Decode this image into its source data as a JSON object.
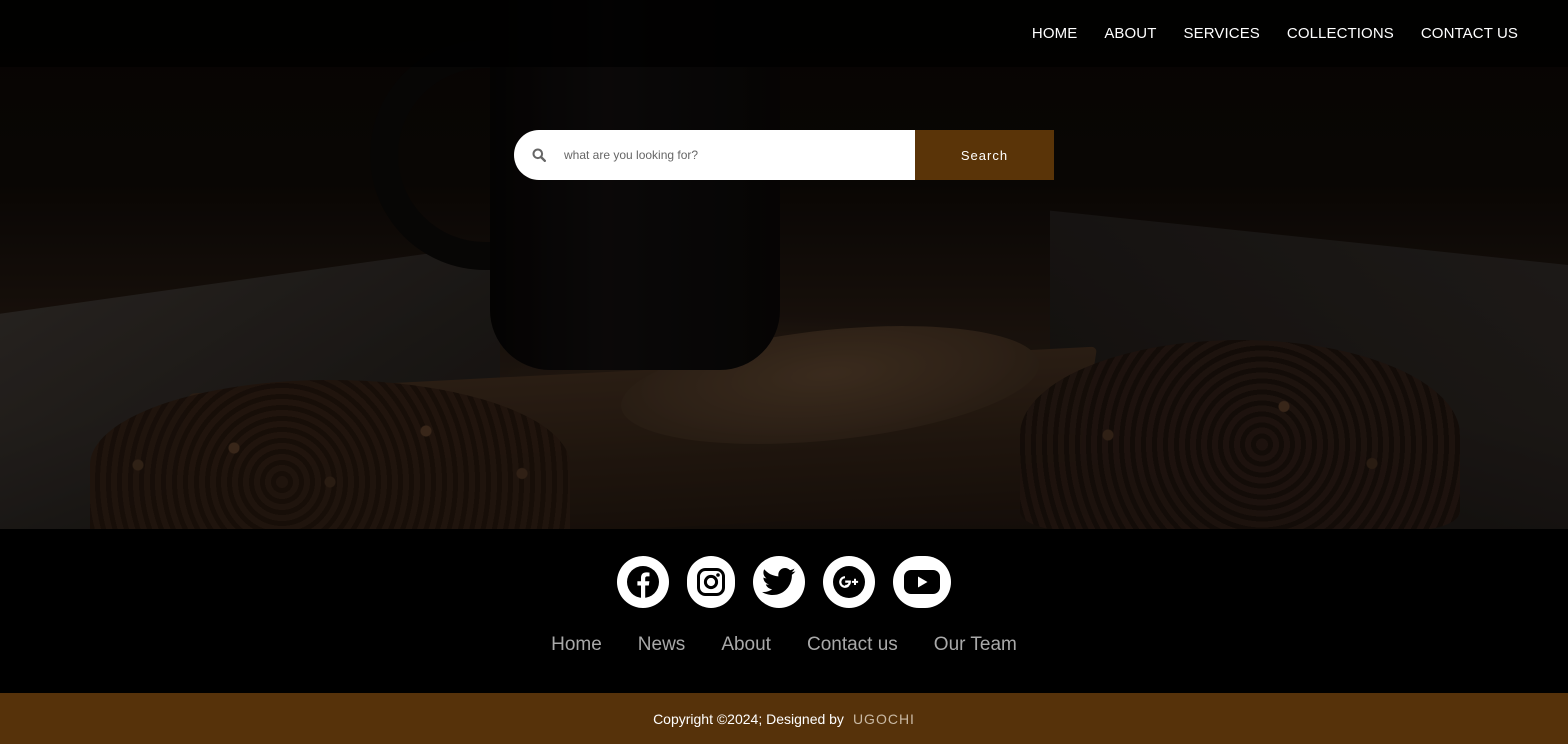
{
  "nav": {
    "items": [
      {
        "label": "HOME"
      },
      {
        "label": "ABOUT"
      },
      {
        "label": "SERVICES"
      },
      {
        "label": "COLLECTIONS"
      },
      {
        "label": "CONTACT US"
      }
    ]
  },
  "search": {
    "placeholder": "what are you looking for?",
    "value": "",
    "button_label": "Search",
    "icon": "search-icon"
  },
  "social": {
    "icons": [
      "facebook-icon",
      "instagram-icon",
      "twitter-icon",
      "google-plus-icon",
      "youtube-icon"
    ]
  },
  "footer": {
    "links": [
      {
        "label": "Home"
      },
      {
        "label": "News"
      },
      {
        "label": "About"
      },
      {
        "label": "Contact us"
      },
      {
        "label": "Our Team"
      }
    ]
  },
  "copyright": {
    "text": "Copyright ©2024; Designed by",
    "author": "UGOCHI"
  },
  "colors": {
    "accent": "#56320a",
    "search_button": "#5a3408",
    "footer_link": "#a9a9a9"
  }
}
